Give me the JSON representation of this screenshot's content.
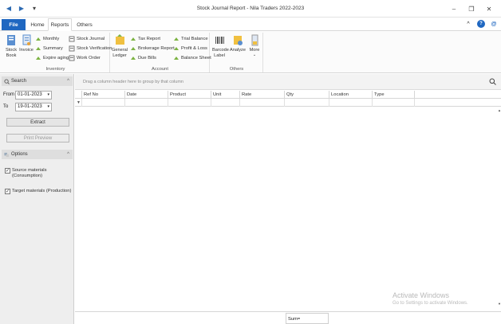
{
  "window": {
    "title": "Stock Journal Report - Nila Traders 2022-2023",
    "nav_back": "◀",
    "nav_forward": "▶",
    "nav_menu": "▾",
    "minimize": "–",
    "maximize": "❐",
    "close": "✕"
  },
  "tabs": {
    "file": "File",
    "home": "Home",
    "reports": "Reports",
    "others": "Others",
    "collapse": "^",
    "help": "?",
    "about": "@"
  },
  "ribbon": {
    "inventory": {
      "label": "Inventory",
      "stock_book": "Stock Book",
      "invoice": "Invoice",
      "monthly": "Monthly",
      "summary": "Summary",
      "expire_aging": "Expire aging",
      "stock_journal": "Stock Journal",
      "stock_verification": "Stock Verification",
      "work_order": "Work Order"
    },
    "account": {
      "label": "Account",
      "general_ledger": "General Ledger",
      "tax_report": "Tax Report",
      "brokerage_report": "Brokerage Report",
      "due_bills": "Due Bills",
      "trial_balance": "Trial Balance",
      "profit_loss": "Profit & Loss",
      "balance_sheet": "Balance Sheet"
    },
    "others": {
      "label": "Others",
      "barcode_label": "Barcode Label",
      "analyze": "Analyze",
      "more": "More",
      "more_chevron": "⌄"
    }
  },
  "search_panel": {
    "title": "Search",
    "collapse": "^",
    "from_label": "From",
    "from_value": "01-01-2023",
    "to_label": "To",
    "to_value": "19-01-2023",
    "dropdown": "▾",
    "extract": "Extract",
    "print_preview": "Print Preview"
  },
  "options_panel": {
    "title": "Options",
    "collapse": "^",
    "source_materials": "Source materials (Consumption)",
    "target_materials": "Target materials (Production)",
    "check": "✓"
  },
  "grid": {
    "group_hint": "Drag a column header here to group by that column",
    "columns": [
      "Ref No",
      "Date",
      "Product",
      "Unit",
      "Rate",
      "Qty",
      "Location",
      "Type"
    ],
    "filter_icon": "▼",
    "scroll_up": "▲",
    "scroll_down": "▼",
    "sum_label": "Sum="
  },
  "watermark": {
    "line1": "Activate Windows",
    "line2": "Go to Settings to activate Windows."
  },
  "colors": {
    "accent": "#1f67c1",
    "ribbon_bg": "#fbfbfb",
    "panel_bg": "#eeeeee"
  }
}
